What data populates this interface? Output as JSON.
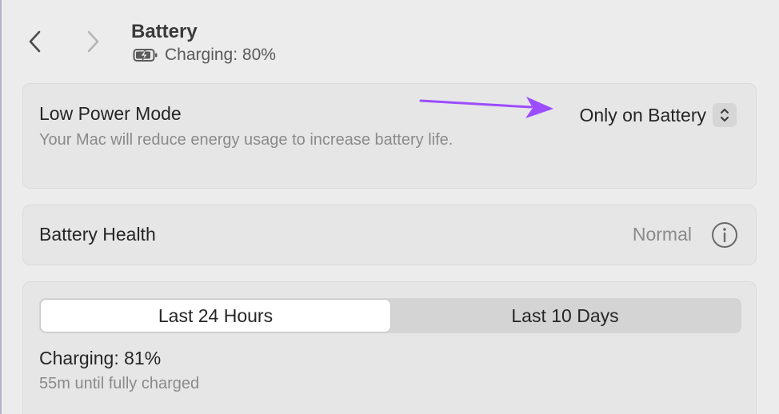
{
  "header": {
    "title": "Battery",
    "status": "Charging: 80%"
  },
  "low_power_mode": {
    "title": "Low Power Mode",
    "description": "Your Mac will reduce energy usage to increase battery life.",
    "selected": "Only on Battery"
  },
  "battery_health": {
    "title": "Battery Health",
    "value": "Normal"
  },
  "usage": {
    "tabs": [
      {
        "label": "Last 24 Hours",
        "active": true
      },
      {
        "label": "Last 10 Days",
        "active": false
      }
    ],
    "status": "Charging: 81%",
    "detail": "55m until fully charged"
  },
  "colors": {
    "annotation_arrow": "#9b4dff"
  }
}
